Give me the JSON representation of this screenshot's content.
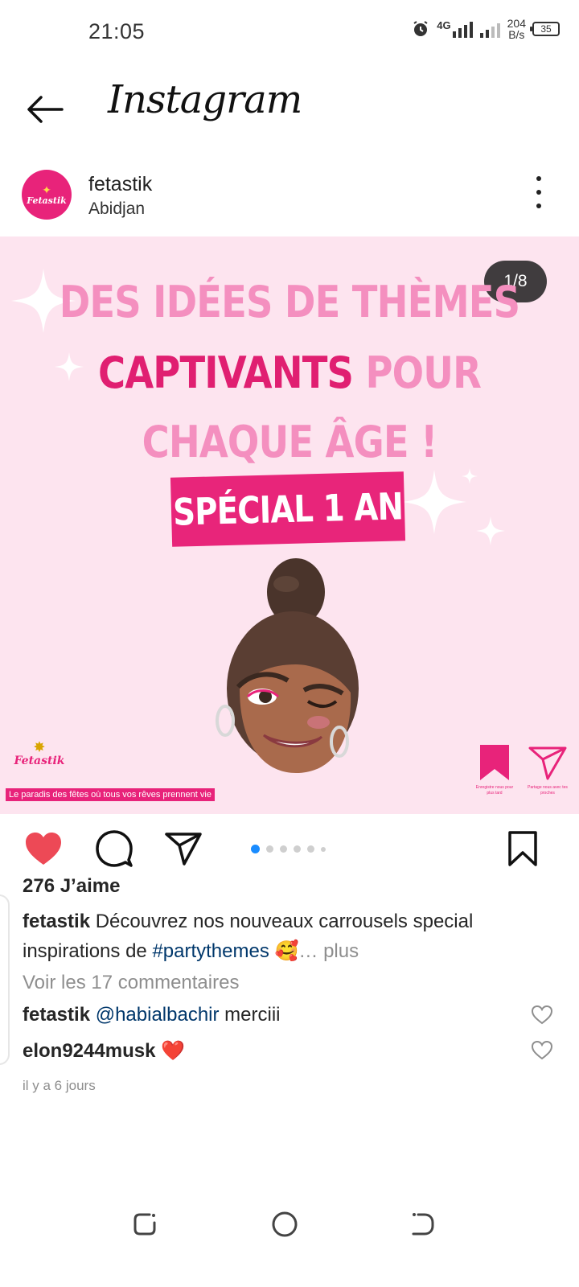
{
  "status_bar": {
    "time": "21:05",
    "network": "4G",
    "speed_value": "204",
    "speed_unit": "B/s",
    "battery": "35"
  },
  "header": {
    "brand": "Instagram"
  },
  "post": {
    "avatar_text": "Fetastik",
    "username": "fetastik",
    "location": "Abidjan",
    "image": {
      "counter": "1/8",
      "line1": "DES IDÉES DE THÈMES",
      "line2_bold": "CAPTIVANTS",
      "line2_soft": " POUR",
      "line3": "CHAQUE ÂGE !",
      "special": "SPÉCIAL 1 AN",
      "brand_logo": "Fetastik",
      "tagline": "Le paradis des fêtes où tous vos rêves prennent vie",
      "save_caption": "Enregistre nous pour plus tard",
      "share_caption": "Partage nous avec tes proches"
    },
    "carousel": {
      "total_dots": 6,
      "active_index": 0
    },
    "likes": "276 J’aime",
    "caption": {
      "user": "fetastik",
      "text": "Découvrez nos nouveaux carrousels special inspirations de ",
      "hashtag": "#partythemes",
      "emoji": "🥰",
      "ellipsis": "…",
      "more": " plus"
    },
    "view_comments": "Voir les 17 commentaires",
    "comments": [
      {
        "user": "fetastik",
        "mention": "@habialbachir",
        "text": " merciii"
      },
      {
        "user": "elon9244musk",
        "text": " ❤️"
      }
    ],
    "timestamp": "il y a 6 jours"
  },
  "colors": {
    "accent_pink": "#e8237a",
    "soft_pink": "#f48fbf",
    "background_pink": "#fde4ef",
    "like_red": "#ed4956",
    "link_blue": "#00376b",
    "dot_blue": "#1a8cff"
  }
}
